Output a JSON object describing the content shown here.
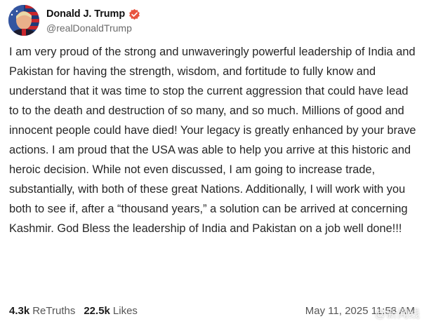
{
  "author": {
    "display_name": "Donald J. Trump",
    "handle": "@realDonaldTrump",
    "verified_badge_color": "#e8543f",
    "avatar": "avatar-portrait-flag"
  },
  "post": {
    "text": "I am very proud of the strong and unwaveringly powerful leadership of India and Pakistan for having the strength, wisdom, and fortitude to fully know and understand that it was time to stop the current aggression that could have lead to to the death and destruction of so many, and so much. Millions of good and innocent people could have died! Your legacy is greatly enhanced by your brave actions. I am proud that the USA was able to help you arrive at this historic and heroic decision. While not even discussed, I am going to increase trade, substantially, with both of these great Nations. Additionally, I will work with you both to see if, after a “thousand years,” a solution can be arrived at concerning Kashmir. God Bless the leadership of India and Pakistan on a job well done!!!"
  },
  "stats": {
    "retruths_count": "4.3k",
    "retruths_label": "ReTruths",
    "likes_count": "22.5k",
    "likes_label": "Likes"
  },
  "timestamp": "May 11, 2025 11:58 AM",
  "watermark": "@新闻线"
}
